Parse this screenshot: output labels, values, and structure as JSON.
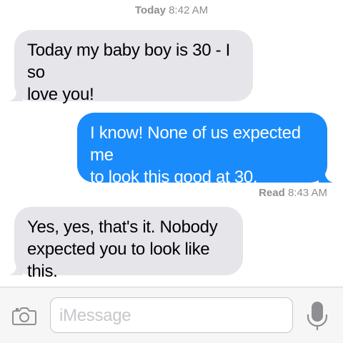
{
  "header": {
    "day": "Today",
    "time": "8:42 AM"
  },
  "messages": [
    {
      "direction": "incoming",
      "line1": "Today my baby boy is 30 - I so",
      "line2": "love you!"
    },
    {
      "direction": "outgoing",
      "line1": "I know! None of us expected me",
      "line2": "to look this good at 30."
    },
    {
      "direction": "incoming",
      "line1": "Yes, yes, that's it.  Nobody",
      "line2": "expected you to look like this."
    }
  ],
  "receipt": {
    "label": "Read",
    "time": "8:43 AM"
  },
  "composer": {
    "placeholder": "iMessage"
  },
  "icons": {
    "camera": "camera-icon",
    "mic": "microphone-icon"
  },
  "colors": {
    "outgoing_bubble": "#1a8bfb",
    "incoming_bubble": "#e5e5ea"
  }
}
